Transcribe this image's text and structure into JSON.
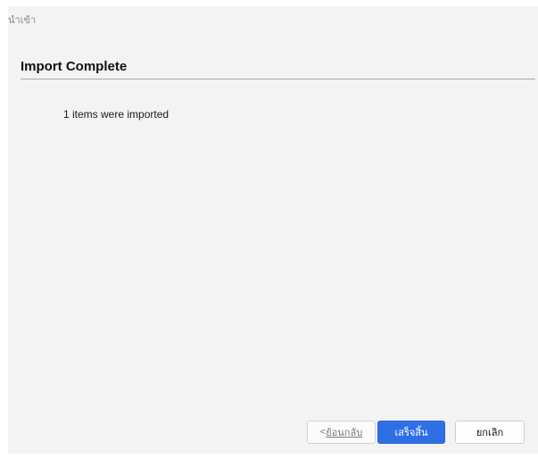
{
  "window": {
    "title": "นำเข้า"
  },
  "page": {
    "heading": "Import Complete",
    "message": "1 items were imported"
  },
  "buttons": {
    "back_prefix": "< ",
    "back_label": "ย้อนกลับ",
    "finish_label": "เสร็จสิ้น",
    "cancel_label": "ยกเลิก"
  },
  "colors": {
    "accent": "#2f6fe6",
    "background": "#f3f3f3",
    "divider": "#a9a9a9"
  }
}
